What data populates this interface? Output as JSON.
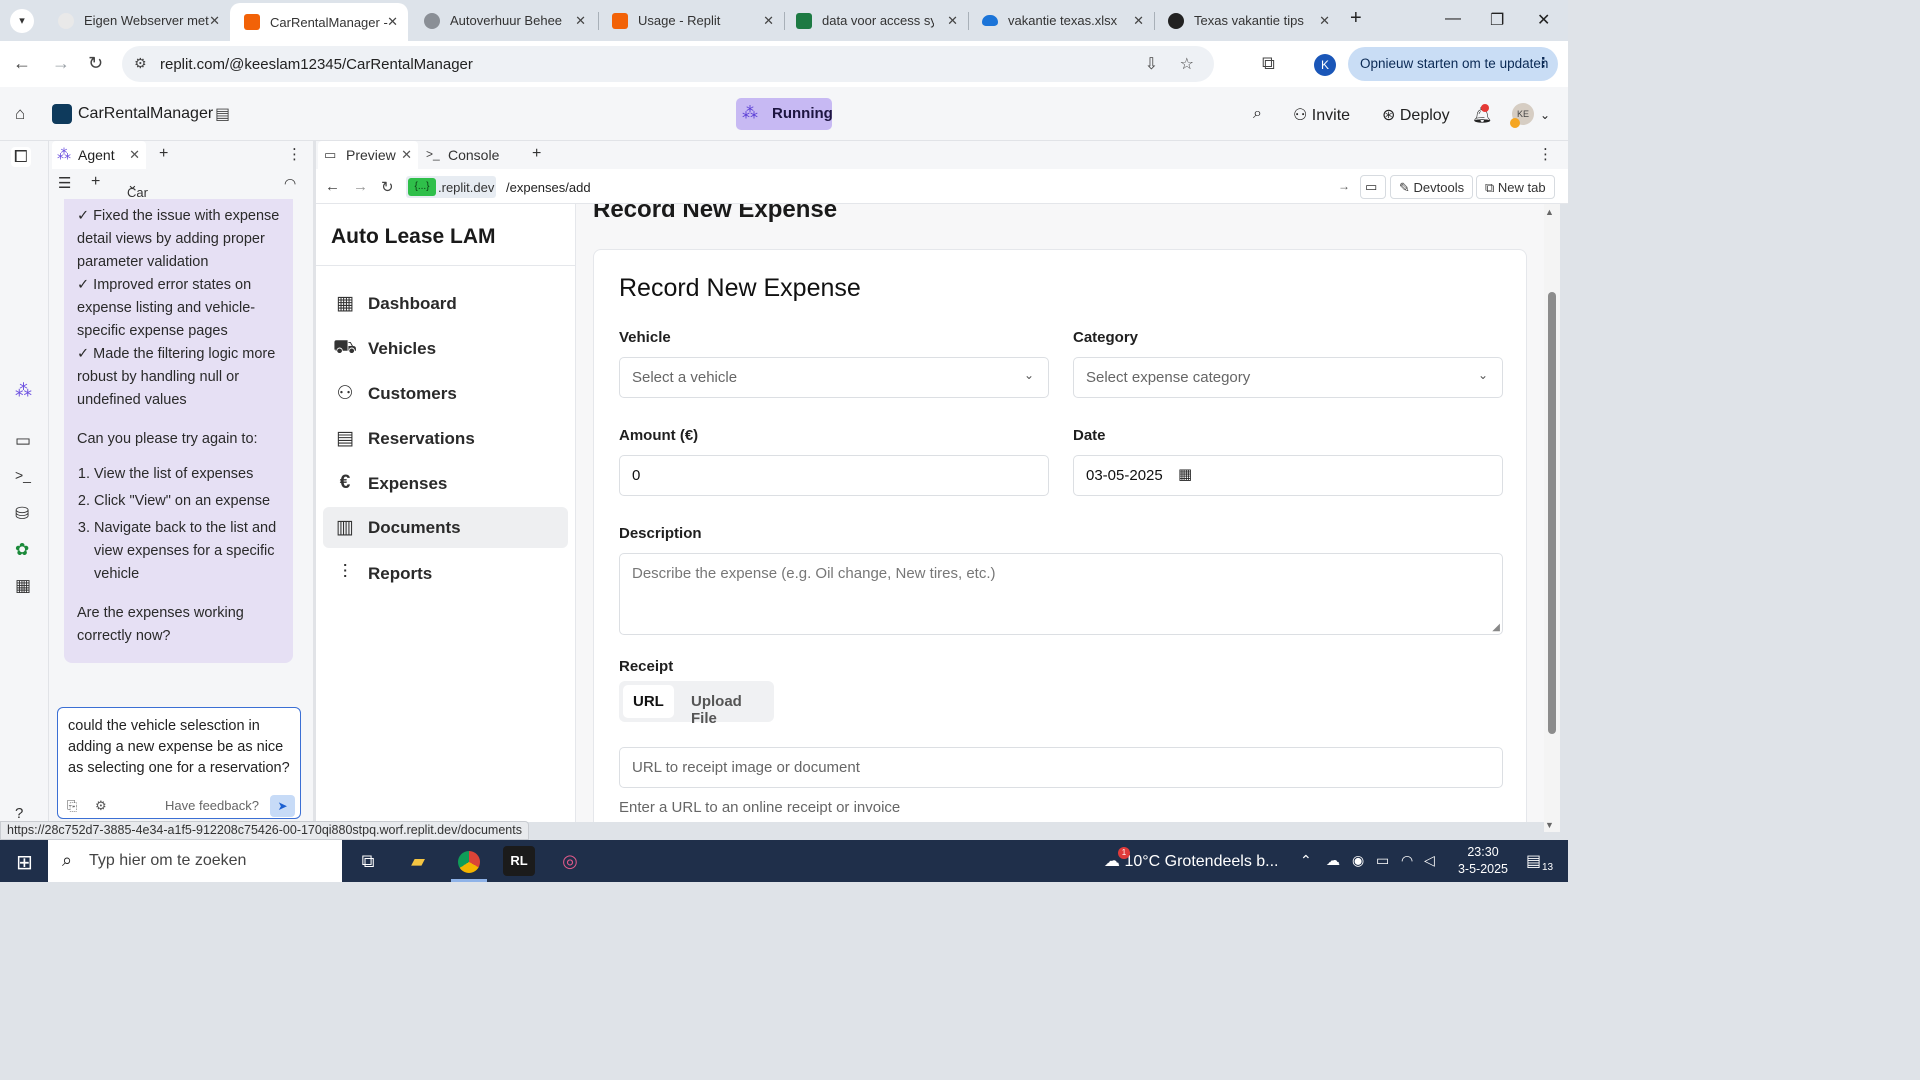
{
  "browser": {
    "tabs": [
      {
        "title": "Eigen Webserver met",
        "icon": "chatgpt-icon"
      },
      {
        "title": "CarRentalManager - I",
        "icon": "replit-icon",
        "active": true
      },
      {
        "title": "Autoverhuur Beheer",
        "icon": "globe-icon"
      },
      {
        "title": "Usage - Replit",
        "icon": "replit-icon"
      },
      {
        "title": "data voor access syst",
        "icon": "excel-icon"
      },
      {
        "title": "vakantie texas.xlsx",
        "icon": "onedrive-icon"
      },
      {
        "title": "Texas vakantie tips",
        "icon": "chatgpt-icon"
      }
    ],
    "new_tab": "+",
    "url": "replit.com/@keeslam12345/CarRentalManager",
    "profile_initial": "K",
    "update_button": "Opnieuw starten om te updaten"
  },
  "replit": {
    "repl_name": "CarRentalManager",
    "status": "Running",
    "invite": "Invite",
    "deploy": "Deploy",
    "avatar_initials": "KE",
    "agent_tab": "Agent",
    "agent_project": "Car Rental Bu...",
    "chat": {
      "lines": [
        "✓ Fixed the issue with expense detail views by adding proper parameter validation",
        "✓ Improved error states on expense listing and vehicle-specific expense pages",
        "✓ Made the filtering logic more robust by handling null or undefined values"
      ],
      "question_intro": "Can you please try again to:",
      "steps": [
        "View the list of expenses",
        "Click \"View\" on an expense",
        "Navigate back to the list and view expenses for a specific vehicle"
      ],
      "closing": "Are the expenses working correctly now?",
      "input_value": "could the vehicle selesction in adding a new expense be as nice as selecting one for a reservation?",
      "feedback": "Have feedback?"
    },
    "preview_tab": "Preview",
    "console_tab": "Console",
    "preview_domain": ".replit.dev",
    "preview_domain_badge": "{...}",
    "preview_path": "/expenses/add",
    "devtools": "Devtools",
    "new_tab": "New tab"
  },
  "app": {
    "brand": "Auto Lease LAM",
    "nav": [
      {
        "label": "Dashboard",
        "icon": "dashboard-icon"
      },
      {
        "label": "Vehicles",
        "icon": "car-icon"
      },
      {
        "label": "Customers",
        "icon": "users-icon"
      },
      {
        "label": "Reservations",
        "icon": "calendar-icon"
      },
      {
        "label": "Expenses",
        "icon": "euro-icon"
      },
      {
        "label": "Documents",
        "icon": "document-icon",
        "hovered": true
      },
      {
        "label": "Reports",
        "icon": "chart-icon"
      }
    ],
    "page_heading": "Record New Expense",
    "form": {
      "title": "Record New Expense",
      "vehicle_label": "Vehicle",
      "vehicle_placeholder": "Select a vehicle",
      "category_label": "Category",
      "category_placeholder": "Select expense category",
      "amount_label": "Amount (€)",
      "amount_value": "0",
      "date_label": "Date",
      "date_value": "03-05-2025",
      "description_label": "Description",
      "description_placeholder": "Describe the expense (e.g. Oil change, New tires, etc.)",
      "receipt_label": "Receipt",
      "receipt_option_url": "URL",
      "receipt_option_upload": "Upload File",
      "receipt_url_placeholder": "URL to receipt image or document",
      "receipt_hint": "Enter a URL to an online receipt or invoice"
    }
  },
  "status_url": "https://28c752d7-3885-4e34-a1f5-912208c75426-00-170qi880stpq.worf.replit.dev/documents",
  "taskbar": {
    "search_placeholder": "Typ hier om te zoeken",
    "weather": "10°C  Grotendeels b...",
    "weather_badge": "1",
    "time": "23:30",
    "date": "3-5-2025",
    "notifications": "13"
  },
  "colors": {
    "accent_blue": "#3b6fd4",
    "running_bg": "#c7b9f3",
    "agent_msg_bg": "#e6e0f4",
    "taskbar_bg": "#1f2f4a"
  }
}
